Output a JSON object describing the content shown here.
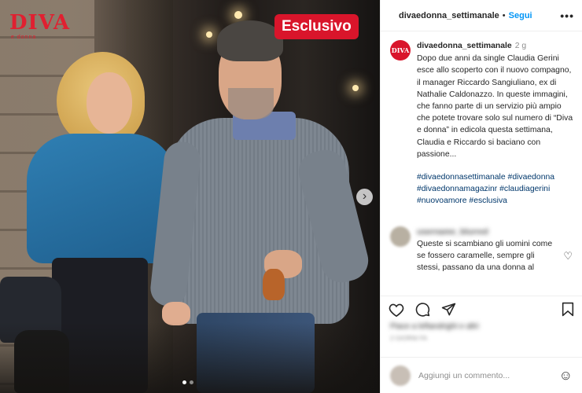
{
  "photo": {
    "logo_text": "DIVA",
    "logo_subtext": "e donna",
    "badge": "Esclusivo",
    "next_button": "›",
    "carousel_dots": 2,
    "carousel_active": 0
  },
  "header": {
    "username": "divaedonna_settimanale",
    "separator": "•",
    "follow": "Segui",
    "more": "•••"
  },
  "caption": {
    "avatar_text": "DIVA",
    "username": "divaedonna_settimanale",
    "time": "2 g",
    "text": "Dopo due anni da single Claudia Gerini esce allo scoperto con il nuovo compagno, il manager Riccardo Sangiuliano, ex di Nathalie Caldonazzo. In queste immagini, che fanno parte di un servizio più ampio che potete trovare solo sul numero di “Diva e donna” in edicola questa settimana, Claudia e Riccardo si baciano con passione...",
    "hashtags": "#divaedonnasettimanale #divaedonna #divaedonnamagazinr #claudiagerini #nuovoamore #esclusiva"
  },
  "comment": {
    "username": "username_blurred",
    "text": "Queste si scambiano gli uomini come se fossero caramelle, sempre gli stessi, passano da una donna al",
    "heart_icon": "heart-outline"
  },
  "actions": {
    "like_icon": "heart-outline",
    "comment_icon": "comment-bubble",
    "share_icon": "paper-plane",
    "save_icon": "bookmark"
  },
  "likes": {
    "blurred_line": "Piace a leftandright e altri",
    "blurred_date": "2 GIORNI FA"
  },
  "add_comment": {
    "placeholder": "Aggiungi un commento...",
    "emoji_icon": "smiley"
  }
}
